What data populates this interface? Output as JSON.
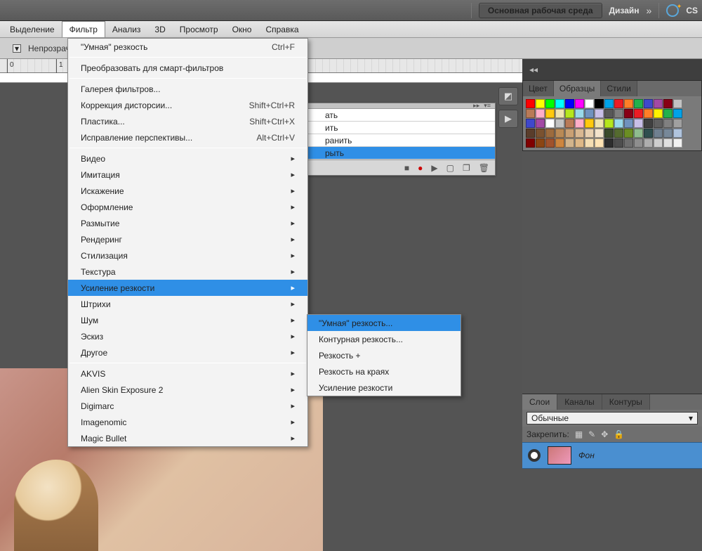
{
  "topbar": {
    "workspace_active": "Основная рабочая среда",
    "workspace_other": "Дизайн",
    "cs_label": "CS"
  },
  "menubar": [
    "Выделение",
    "Фильтр",
    "Анализ",
    "3D",
    "Просмотр",
    "Окно",
    "Справка"
  ],
  "opacity_label": "Непрозрачн",
  "filter_menu": {
    "recent": {
      "label": "\"Умная\" резкость",
      "shortcut": "Ctrl+F"
    },
    "convert": "Преобразовать для смарт-фильтров",
    "group1": [
      {
        "label": "Галерея фильтров...",
        "shortcut": ""
      },
      {
        "label": "Коррекция дисторсии...",
        "shortcut": "Shift+Ctrl+R"
      },
      {
        "label": "Пластика...",
        "shortcut": "Shift+Ctrl+X"
      },
      {
        "label": "Исправление перспективы...",
        "shortcut": "Alt+Ctrl+V"
      }
    ],
    "cats": [
      "Видео",
      "Имитация",
      "Искажение",
      "Оформление",
      "Размытие",
      "Рендеринг",
      "Стилизация",
      "Текстура",
      "Усиление резкости",
      "Штрихи",
      "Шум",
      "Эскиз",
      "Другое"
    ],
    "cat_hl_index": 8,
    "plugins": [
      "AKVIS",
      "Alien Skin Exposure 2",
      "Digimarc",
      "Imagenomic",
      "Magic Bullet"
    ]
  },
  "sharpen_submenu": {
    "items": [
      "\"Умная\" резкость...",
      "Контурная резкость...",
      "Резкость +",
      "Резкость на краях",
      "Усиление резкости"
    ],
    "hl_index": 0
  },
  "actions_panel": {
    "rows": [
      "ать",
      "ить",
      "ранить",
      "рыть"
    ],
    "sel_index": 3
  },
  "swatches": {
    "tabs": [
      "Цвет",
      "Образцы",
      "Стили"
    ],
    "active": 1,
    "colors": [
      "#ff0000",
      "#ffff00",
      "#00ff00",
      "#00ffff",
      "#0000ff",
      "#ff00ff",
      "#ffffff",
      "#000000",
      "#00a2e8",
      "#ed1c24",
      "#ff7f27",
      "#22b14c",
      "#3f48cc",
      "#a349a4",
      "#880015",
      "#c3c3c3",
      "#b97a57",
      "#ffaec9",
      "#ffc90e",
      "#efe4b0",
      "#b5e61d",
      "#99d9ea",
      "#7092be",
      "#c8bfe7",
      "#585858",
      "#7f7f7f",
      "#880015",
      "#ed1c24",
      "#ff7f27",
      "#fff200",
      "#22b14c",
      "#00a2e8",
      "#3f48cc",
      "#a349a4",
      "#ffffff",
      "#c3c3c3",
      "#b97a57",
      "#ffaec9",
      "#ffc90e",
      "#efe4b0",
      "#b5e61d",
      "#99d9ea",
      "#7092be",
      "#c8bfe7",
      "#404040",
      "#606060",
      "#808080",
      "#a0a0a0",
      "#5a3d2b",
      "#7a5230",
      "#9c6b3e",
      "#b98a56",
      "#c9a074",
      "#d9b892",
      "#e8d0b0",
      "#f3e3cc",
      "#3b4a2b",
      "#556b2f",
      "#6b8e23",
      "#8fbc8f",
      "#2f4f4f",
      "#708090",
      "#778899",
      "#b0c4de",
      "#800000",
      "#8b4513",
      "#a0522d",
      "#cd853f",
      "#d2b48c",
      "#deb887",
      "#f5deb3",
      "#ffe4b5",
      "#2e2e2e",
      "#4e4e4e",
      "#6e6e6e",
      "#8e8e8e",
      "#aeaeae",
      "#cecece",
      "#e0e0e0",
      "#f2f2f2"
    ]
  },
  "layers": {
    "tabs": [
      "Слои",
      "Каналы",
      "Контуры"
    ],
    "active": 0,
    "mode": "Обычные",
    "lock_label": "Закрепить:",
    "layer_name": "Фон"
  }
}
